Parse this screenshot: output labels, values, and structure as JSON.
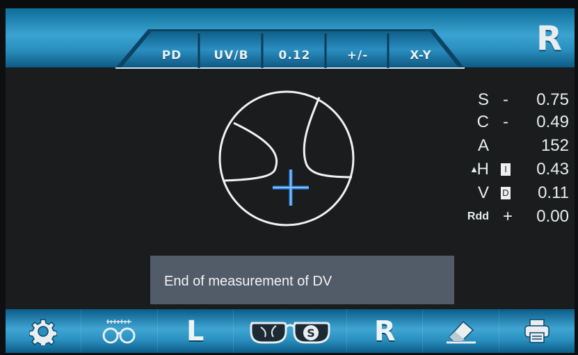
{
  "header": {
    "tabs": [
      {
        "label": "PD"
      },
      {
        "label": "UV/B"
      },
      {
        "label": "0.12"
      },
      {
        "label": "+/-"
      },
      {
        "label": "X-Y"
      }
    ],
    "side": "R"
  },
  "readings": {
    "S": {
      "label": "S",
      "sign": "-",
      "value": "0.75"
    },
    "C": {
      "label": "C",
      "sign": "-",
      "value": "0.49"
    },
    "A": {
      "label": "A",
      "value": "152"
    },
    "H": {
      "label": "H",
      "badge": "I",
      "value": "0.43"
    },
    "V": {
      "label": "V",
      "badge": "D",
      "value": "0.11"
    },
    "Rdd": {
      "label": "Rdd",
      "sign": "+",
      "value": "0.00"
    }
  },
  "message": "End of measurement of DV",
  "toolbar": {
    "left_label": "L",
    "lens_label": "S",
    "right_label": "R"
  },
  "colors": {
    "accent": "#3aa3d1",
    "crosshair": "#2f86e6",
    "screen_bg": "#1a1c1d"
  }
}
